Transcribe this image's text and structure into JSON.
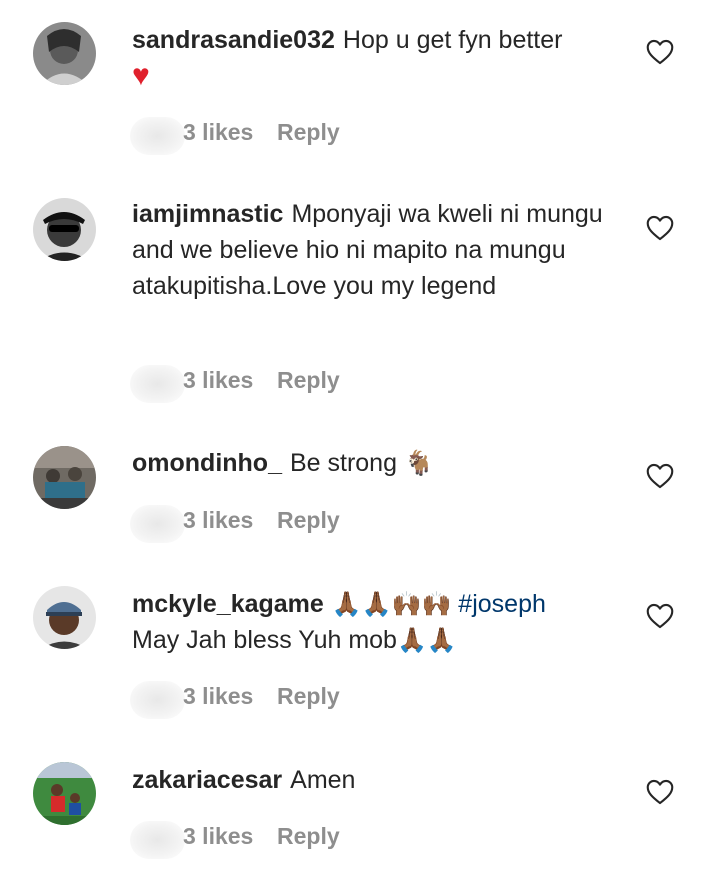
{
  "comments": [
    {
      "username": "sandrasandie032",
      "text": "Hop u get fyn better",
      "extra": "♥",
      "likes": "3 likes",
      "reply": "Reply"
    },
    {
      "username": "iamjimnastic",
      "text": "Mponyaji wa kweli ni mungu and we believe hio ni mapito na mungu atakupitisha.Love you my legend",
      "likes": "3 likes",
      "reply": "Reply"
    },
    {
      "username": "omondinho_",
      "text": "Be strong",
      "emoji": "🐐",
      "likes": "3 likes",
      "reply": "Reply"
    },
    {
      "username": "mckyle_kagame",
      "emojis": "🙏🏾🙏🏾🙌🏾🙌🏾",
      "hashtag": "#joseph",
      "text": "May Jah bless Yuh mob",
      "emojis_end": "🙏🏾🙏🏾",
      "likes": "3 likes",
      "reply": "Reply"
    },
    {
      "username": "zakariacesar",
      "text": "Amen",
      "likes": "3 likes",
      "reply": "Reply"
    }
  ],
  "icons": {
    "like": "heart-outline-icon"
  },
  "colors": {
    "text": "#262626",
    "meta": "#8e8e8e",
    "hashtag": "#00376b",
    "heart": "#e0202c"
  }
}
